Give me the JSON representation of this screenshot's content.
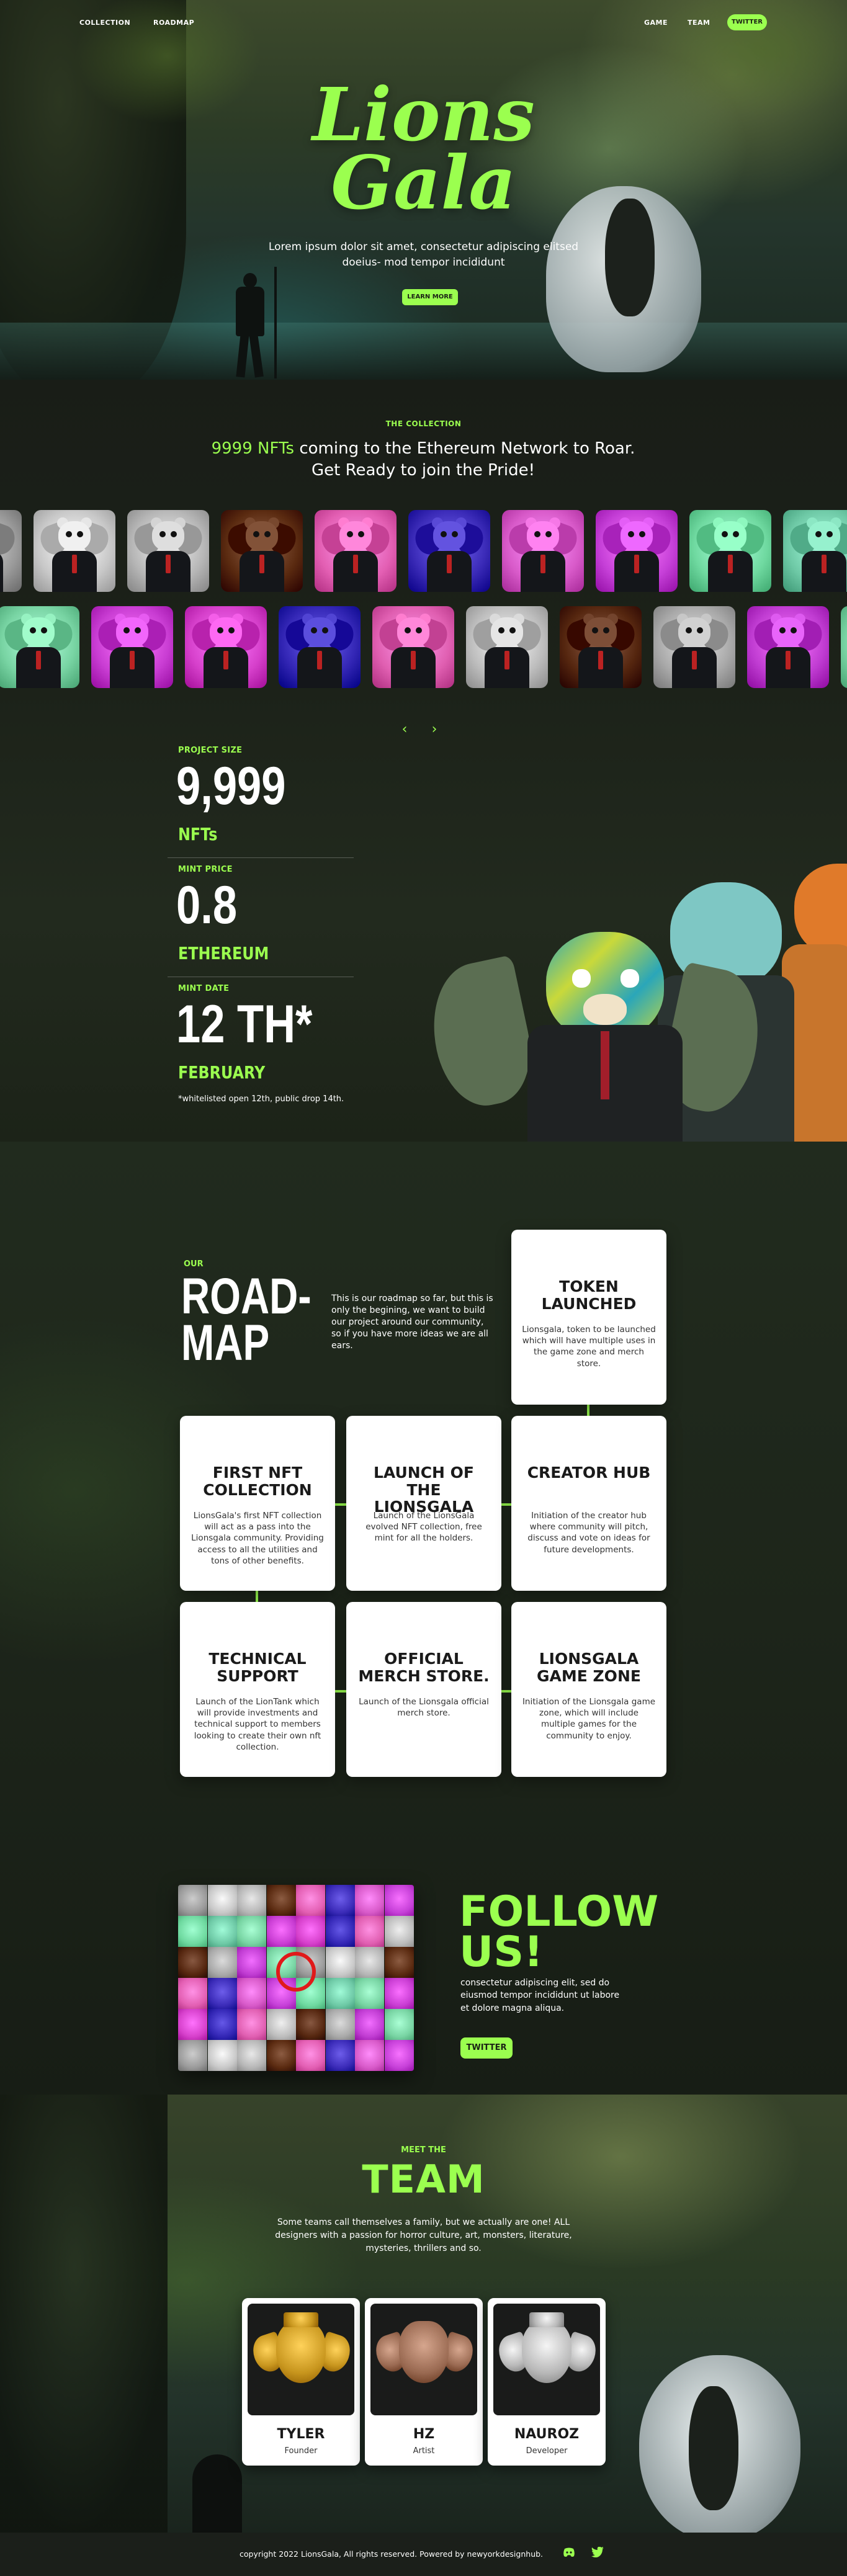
{
  "nav": {
    "left": [
      "COLLECTION",
      "ROADMAP"
    ],
    "right": [
      "GAME",
      "TEAM"
    ],
    "twitter_label": "TWITTER"
  },
  "hero": {
    "title_line1": "Lions",
    "title_line2": "Gala",
    "subtitle": "Lorem ipsum dolor sit amet, consectetur adipiscing elitsed doeius- mod tempor incididunt",
    "button": "LEARN MORE"
  },
  "collection": {
    "eyebrow": "THE COLLECTION",
    "heading_highlight": "9999 NFTs",
    "heading_rest": " coming to the Ethereum Network to Roar.",
    "heading_line2": "Get Ready to join the Pride!",
    "arrow_prev": "‹",
    "arrow_next": "›",
    "row1_colors": [
      "#9a9a9a",
      "#c8c8c8",
      "#b6b6b6",
      "#5a2a10",
      "#e35fb3",
      "#3b2bb8",
      "#d85ac9",
      "#c640d8",
      "#6fd9a0",
      "#6ec9a6"
    ],
    "row2_colors": [
      "#78d4a3",
      "#c93dd3",
      "#d640cb",
      "#3326b5",
      "#e05fb1",
      "#bdbdbd",
      "#55260f",
      "#a9a9a9",
      "#c03cd2",
      "#78d4a3"
    ]
  },
  "stats": [
    {
      "label": "PROJECT SIZE",
      "value": "9,999",
      "unit": "NFTs"
    },
    {
      "label": "MINT PRICE",
      "value": "0.8",
      "unit": "ETHEREUM"
    },
    {
      "label": "MINT DATE",
      "value": "12 TH*",
      "unit": "FEBRUARY"
    }
  ],
  "stats_note": "*whitelisted open 12th, public drop 14th.",
  "roadmap": {
    "eyebrow": "OUR",
    "title": "ROAD-\nMAP",
    "intro": "This is our roadmap so far, but this is only the begining, we want to build our project around our community, so if you have more ideas we are all ears.",
    "cards": [
      {
        "title": "TOKEN LAUNCHED",
        "text": "Lionsgala, token to be launched which will have multiple uses in the game zone and merch store."
      },
      {
        "title": "FIRST NFT COLLECTION",
        "text": "LionsGala's first NFT collection will act as a pass into the Lionsgala community. Providing access to all the utilities and tons of other benefits."
      },
      {
        "title": "LAUNCH OF THE LIONSGALA",
        "text": "Launch of the LionsGala evolved NFT collection, free mint for all the holders."
      },
      {
        "title": "CREATOR HUB",
        "text": "Initiation of the creator hub where community will pitch, discuss and vote on ideas for future developments."
      },
      {
        "title": "TECHNICAL SUPPORT",
        "text": "Launch of the LionTank which will provide investments and technical support to members looking to create their own nft collection."
      },
      {
        "title": "OFFICIAL MERCH STORE.",
        "text": "Launch of the Lionsgala official merch store."
      },
      {
        "title": "LIONSGALA GAME ZONE",
        "text": "Initiation of the Lionsgala game zone, which will include multiple games for the community to enjoy."
      }
    ]
  },
  "follow": {
    "title_line1": "FOLLOW",
    "title_line2": "US!",
    "text": "consectetur adipiscing elit, sed do eiusmod tempor incididunt ut labore et dolore magna aliqua.",
    "button": "TWITTER"
  },
  "team": {
    "eyebrow": "MEET THE",
    "title": "TEAM",
    "text": "Some teams call themselves a family, but we actually are one! ALL designers with a passion for horror culture, art, monsters, literature, mysteries, thrillers and so.",
    "members": [
      {
        "name": "TYLER",
        "role": "Founder",
        "crest_color": "#c8961e"
      },
      {
        "name": "HZ",
        "role": "Artist",
        "crest_color": "#9a6a52"
      },
      {
        "name": "NAUROZ",
        "role": "Developer",
        "crest_color": "#b9b9b9"
      }
    ]
  },
  "footer": {
    "text": "copyright 2022 LionsGala, All rights reserved. Powered by newyorkdesignhub.",
    "icons": [
      "discord-icon",
      "twitter-icon"
    ]
  },
  "colors": {
    "accent": "#9bff4f",
    "dark": "#181c16",
    "card": "#ffffff"
  }
}
